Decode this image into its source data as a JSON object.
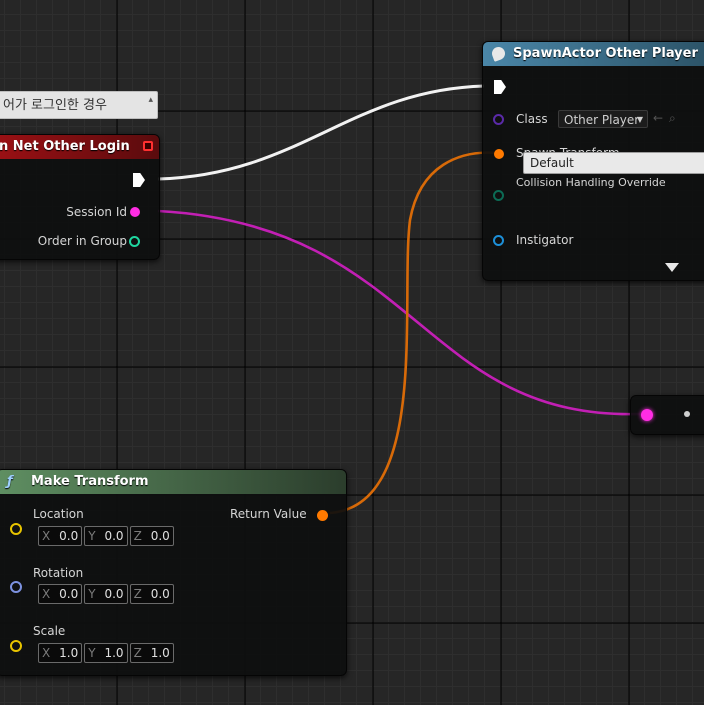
{
  "comment": {
    "text": "어가 로그인한 경우"
  },
  "event_node": {
    "title": "n Net Other Login",
    "pins": {
      "session_id": "Session Id",
      "order_in_group": "Order in Group"
    }
  },
  "spawn_node": {
    "title": "SpawnActor Other Player",
    "pins": {
      "class": "Class",
      "class_value": "Other Player",
      "spawn_transform": "Spawn Transform",
      "collision": "Collision Handling Override",
      "collision_value": "Default",
      "instigator": "Instigator"
    }
  },
  "make_transform_node": {
    "title": "Make Transform",
    "return_value": "Return Value",
    "location": {
      "label": "Location",
      "x": "0.0",
      "y": "0.0",
      "z": "0.0"
    },
    "rotation": {
      "label": "Rotation",
      "x": "0.0",
      "y": "0.0",
      "z": "0.0"
    },
    "scale": {
      "label": "Scale",
      "x": "1.0",
      "y": "1.0",
      "z": "1.0"
    }
  },
  "axes": {
    "x": "X",
    "y": "Y",
    "z": "Z"
  },
  "colors": {
    "exec_wire": "#ffffff",
    "string_pin": "#ff2de3",
    "struct_pin": "#ff7a00",
    "class_pin": "#5a2aa8",
    "object_pin": "#1d8fd8",
    "int_pin": "#1fd6a0",
    "event_header": "#8a0f12",
    "function_header": "#5d8a5d",
    "spawn_header": "#3a6e8a"
  }
}
